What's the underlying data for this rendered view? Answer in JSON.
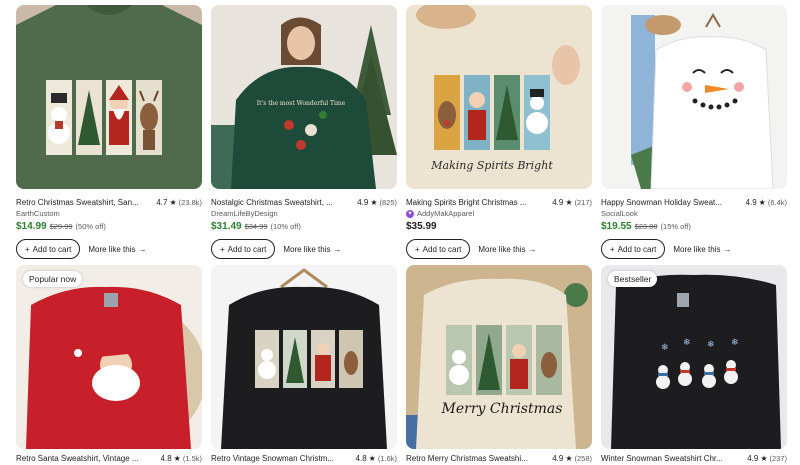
{
  "listings_row1": [
    {
      "title": "Retro Christmas Sweatshirt, San...",
      "rating": "4.7",
      "reviews": "(23.8k)",
      "shop": "EarthCustom",
      "star_seller": false,
      "price": "$14.99",
      "original": "$29.99",
      "discount": "(50% off)",
      "sale": true,
      "add_label": "Add to cart",
      "more_label": "More like this"
    },
    {
      "title": "Nostalgic Christmas Sweatshirt, ...",
      "rating": "4.9",
      "reviews": "(825)",
      "shop": "DreamLifeByDesign",
      "star_seller": false,
      "price": "$31.49",
      "original": "$34.99",
      "discount": "(10% off)",
      "sale": true,
      "add_label": "Add to cart",
      "more_label": "More like this"
    },
    {
      "title": "Making Spirits Bright Christmas ...",
      "rating": "4.9",
      "reviews": "(217)",
      "shop": "AddyMakApparel",
      "star_seller": true,
      "price": "$35.99",
      "original": "",
      "discount": "",
      "sale": false,
      "add_label": "Add to cart",
      "more_label": "More like this"
    },
    {
      "title": "Happy Snowman Holiday Sweat...",
      "rating": "4.9",
      "reviews": "(6.4k)",
      "shop": "SocialLook",
      "star_seller": false,
      "price": "$19.55",
      "original": "$23.00",
      "discount": "(15% off)",
      "sale": true,
      "add_label": "Add to cart",
      "more_label": "More like this"
    }
  ],
  "listings_row2": [
    {
      "title": "Retro Santa Sweatshirt, Vintage ...",
      "rating": "4.8",
      "reviews": "(1.5k)",
      "badge": "Popular now"
    },
    {
      "title": "Retro Vintage Snowman Christm...",
      "rating": "4.8",
      "reviews": "(1.6k)",
      "badge": ""
    },
    {
      "title": "Retro Merry Christmas Sweatshi...",
      "rating": "4.9",
      "reviews": "(258)",
      "badge": ""
    },
    {
      "title": "Winter Snowman Sweatshirt Chr...",
      "rating": "4.9",
      "reviews": "(237)",
      "badge": "Bestseller"
    }
  ],
  "image_text": {
    "spirits": "Making Spirits Bright",
    "merry": "Merry Christmas",
    "wonderful": "It's the most Wonderful Time"
  },
  "icons": {
    "star": "★",
    "plus": "+",
    "arrow": "→",
    "star_seller": "✦"
  },
  "colors": {
    "sale_price": "#2f7d32",
    "star_seller_badge": "#8a4fd6",
    "green_sweater": "#4f6b4c",
    "dark_green_sweater": "#1e4a3a",
    "cream_sweater": "#ede3d1",
    "red_sweater": "#c8202a",
    "black_sweater": "#1d1d1f"
  }
}
